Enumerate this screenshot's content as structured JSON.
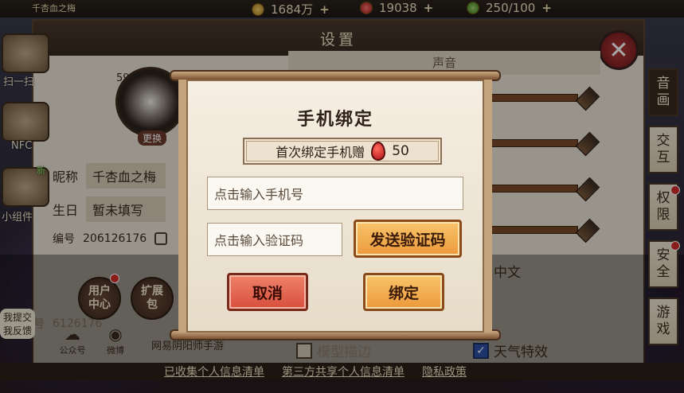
{
  "topbar": {
    "player_title": "千杏血之梅",
    "resources": [
      {
        "name": "gold",
        "value": "1684万"
      },
      {
        "name": "jade",
        "value": "19038"
      },
      {
        "name": "stamina",
        "value": "250/100"
      }
    ],
    "plus_symbol": "+"
  },
  "settings": {
    "title": "设置",
    "close_glyph": "✕",
    "profile": {
      "level": "59",
      "change_label": "更换",
      "nickname_label": "昵称",
      "nickname_value": "千杏血之梅",
      "birthday_label": "生日",
      "birthday_value": "暂未填写",
      "id_label": "编号",
      "id_value": "206126176",
      "former_id_label": "曾用编号",
      "former_id_value": "6126176"
    },
    "user_center": "用户中心",
    "expansion_pack": "扩展包",
    "social": {
      "official_account": "公众号",
      "weibo": "微博"
    },
    "publisher": "网易阴阳师手游",
    "sound_header": "声音",
    "language_value": "中文",
    "checkboxes": [
      {
        "label": "模型描边",
        "checked": false
      },
      {
        "label": "天气特效",
        "checked": true
      }
    ],
    "tabs": [
      "音画",
      "交互",
      "权限",
      "安全",
      "游戏"
    ]
  },
  "floating": {
    "scan": "扫一扫",
    "nfc": "NFC",
    "widget": "小组件",
    "new_badge": "新",
    "feedback": "我提交\n我反馈"
  },
  "privacy_links": [
    "已收集个人信息清单",
    "第三方共享个人信息清单",
    "隐私政策"
  ],
  "modal": {
    "title": "手机绑定",
    "reward_text": "首次绑定手机赠",
    "reward_count": "50",
    "phone_placeholder": "点击输入手机号",
    "code_placeholder": "点击输入验证码",
    "send_code_label": "发送验证码",
    "cancel_label": "取消",
    "bind_label": "绑定"
  },
  "colors": {
    "accent_orange": "#f0a54a",
    "cancel_red": "#e06a55",
    "parchment": "#f3ecdf",
    "wood": "#c4a47c"
  }
}
